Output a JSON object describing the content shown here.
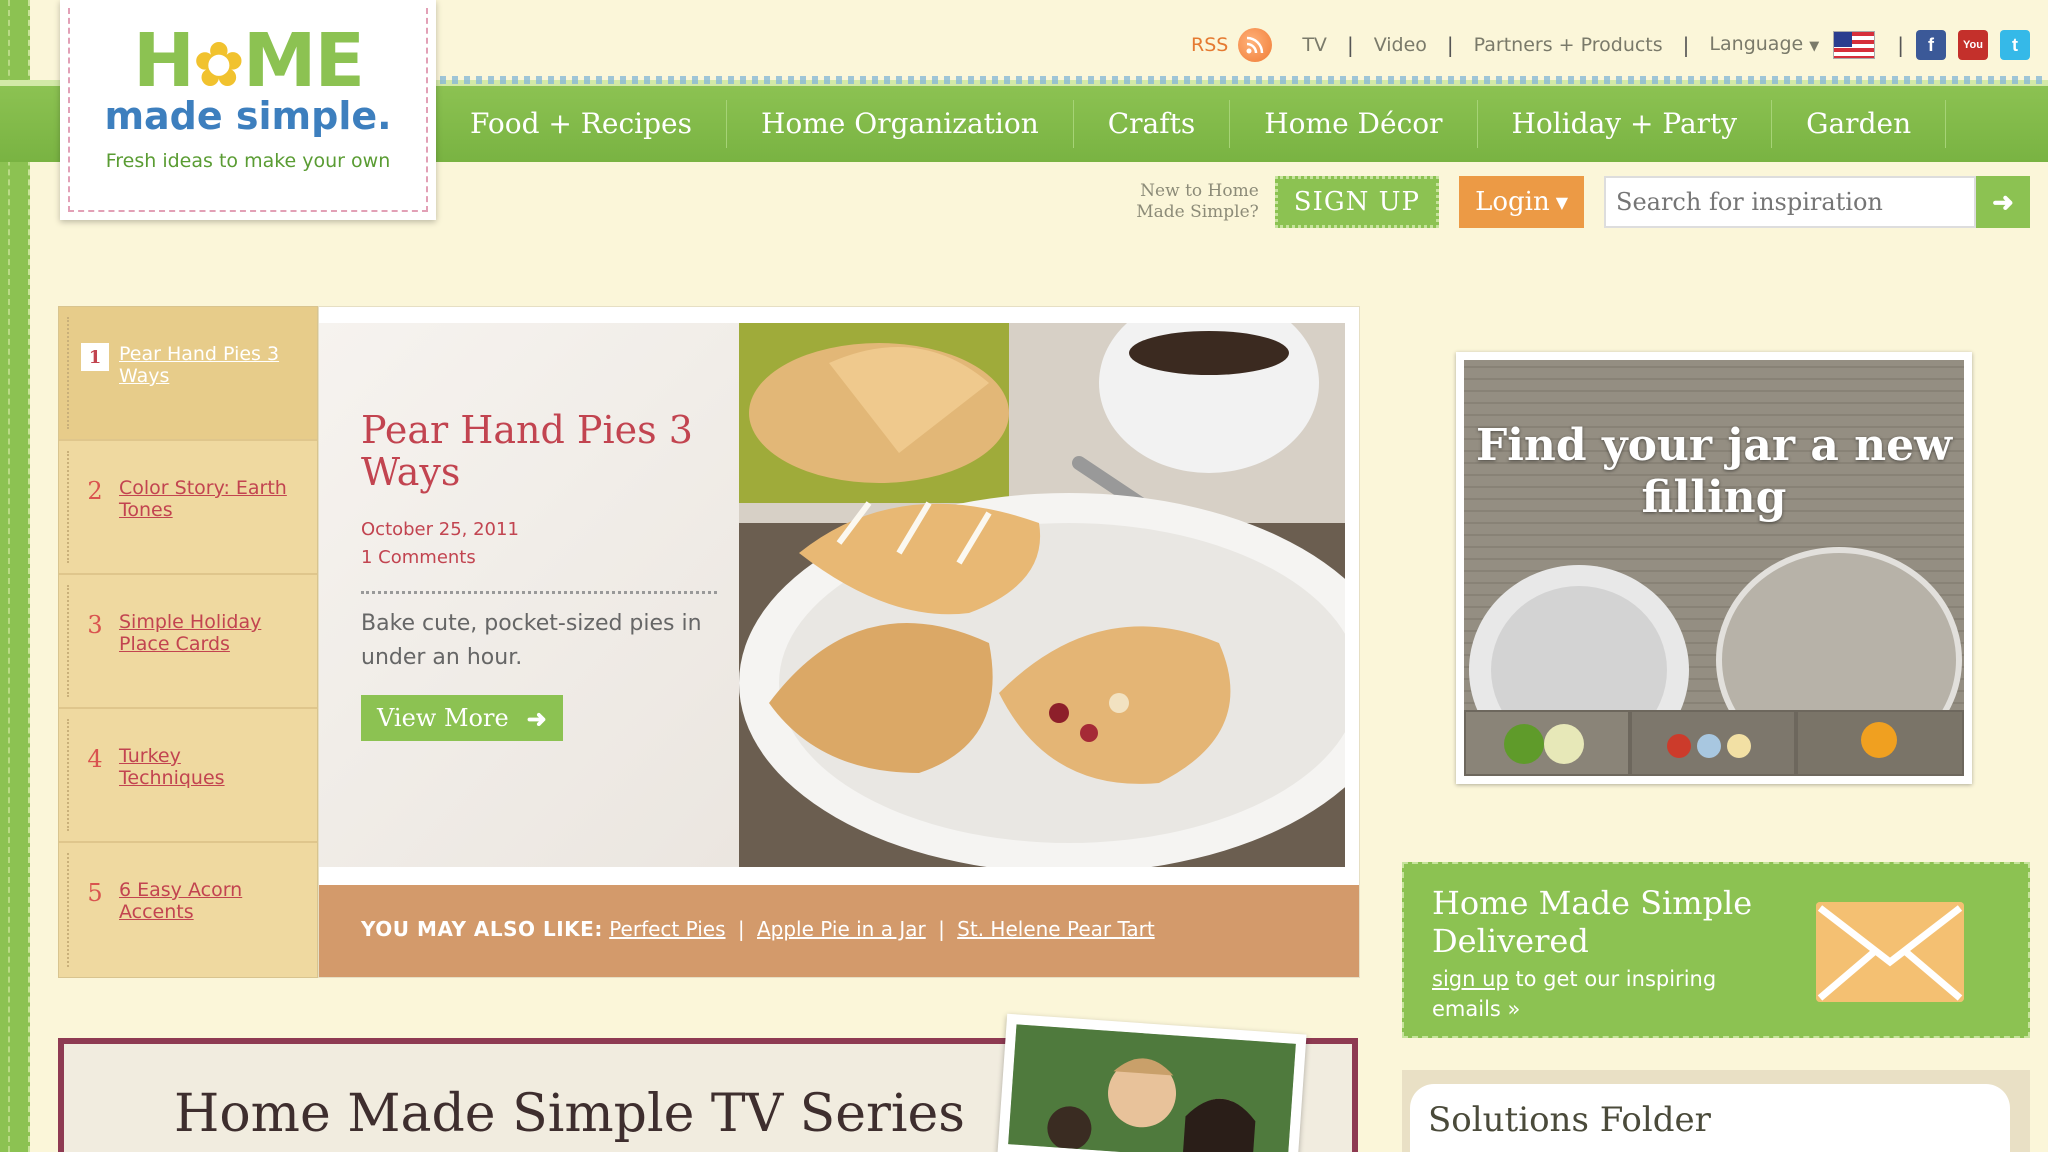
{
  "topbar": {
    "rss_label": "RSS",
    "tv_label": "TV",
    "video_label": "Video",
    "partners_label": "Partners + Products",
    "language_label": "Language"
  },
  "logo": {
    "line1": "HOME",
    "line2": "made simple.",
    "tagline": "Fresh ideas to make your own"
  },
  "nav": {
    "items": [
      "Food + Recipes",
      "Home Organization",
      "Crafts",
      "Home Décor",
      "Holiday + Party",
      "Garden"
    ]
  },
  "account": {
    "new_to_line1": "New to Home",
    "new_to_line2": "Made Simple?",
    "signup_label": "SIGN UP",
    "login_label": "Login",
    "search_placeholder": "Search for inspiration"
  },
  "features": {
    "items": [
      {
        "num": "1",
        "label": "Pear Hand Pies 3 Ways",
        "active": true
      },
      {
        "num": "2",
        "label": "Color Story: Earth Tones",
        "active": false
      },
      {
        "num": "3",
        "label": "Simple Holiday Place Cards",
        "active": false
      },
      {
        "num": "4",
        "label": "Turkey Techniques",
        "active": false
      },
      {
        "num": "5",
        "label": "6 Easy Acorn Accents",
        "active": false
      }
    ],
    "main": {
      "title": "Pear Hand Pies 3 Ways",
      "date": "October 25, 2011",
      "comments": "1 Comments",
      "description": "Bake cute, pocket-sized pies in under an hour.",
      "button_label": "View More"
    },
    "also_like": {
      "label": "YOU MAY ALSO LIKE:",
      "links": [
        "Perfect Pies",
        "Apple Pie in a Jar",
        "St. Helene Pear Tart"
      ]
    }
  },
  "promos": {
    "jar_title": "Find your jar a new filling",
    "delivered_title": "Home Made Simple Delivered",
    "delivered_link": "sign up",
    "delivered_text": "to get our inspiring emails »",
    "solutions_title": "Solutions Folder"
  },
  "tv": {
    "title": "Home Made Simple TV Series"
  },
  "colors": {
    "brand_green": "#8cc252",
    "accent_red": "#c24450",
    "login_orange": "#ec9a45",
    "background": "#fbf6d9"
  }
}
